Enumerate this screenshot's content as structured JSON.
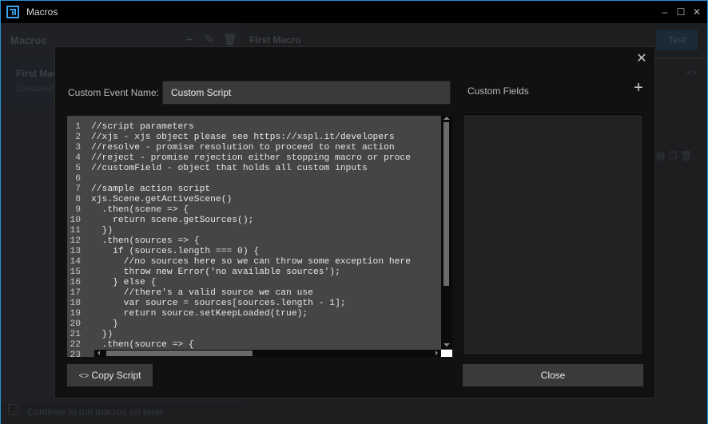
{
  "window": {
    "title": "Macros",
    "controls": {
      "minimize": "–",
      "maximize": "☐",
      "close": "✕"
    }
  },
  "background": {
    "left_header": "Macros",
    "left_icons": [
      "plus-icon",
      "edit-icon",
      "trash-icon"
    ],
    "macro_item": {
      "name": "First Macro",
      "status": "(Disabled)"
    },
    "right_title": "First Macro",
    "test_button": "Test",
    "code_icon": "<>",
    "footer_checkbox_label": "Continue to run macros on error"
  },
  "modal": {
    "close": "✕",
    "event_name_label": "Custom Event Name:",
    "event_name_value": "Custom Script",
    "custom_fields_label": "Custom Fields",
    "add_field": "+",
    "copy_button": "Copy Script",
    "copy_icon": "<>",
    "close_button": "Close",
    "code_lines": [
      {
        "n": "1",
        "text": "//script parameters"
      },
      {
        "n": "2",
        "text": "//xjs - xjs object please see https://xspl.it/developers"
      },
      {
        "n": "3",
        "text": "//resolve - promise resolution to proceed to next action"
      },
      {
        "n": "4",
        "text": "//reject - promise rejection either stopping macro or proce"
      },
      {
        "n": "5",
        "text": "//customField - object that holds all custom inputs"
      },
      {
        "n": "6",
        "text": ""
      },
      {
        "n": "7",
        "text": "//sample action script"
      },
      {
        "n": "8",
        "text": "xjs.Scene.getActiveScene()"
      },
      {
        "n": "9",
        "text": "  .then(scene => {"
      },
      {
        "n": "10",
        "text": "    return scene.getSources();"
      },
      {
        "n": "11",
        "text": "  })"
      },
      {
        "n": "12",
        "text": "  .then(sources => {"
      },
      {
        "n": "13",
        "text": "    if (sources.length === 0) {"
      },
      {
        "n": "14",
        "text": "      //no sources here so we can throw some exception here"
      },
      {
        "n": "15",
        "text": "      throw new Error('no available sources');"
      },
      {
        "n": "16",
        "text": "    } else {"
      },
      {
        "n": "17",
        "text": "      //there's a valid source we can use"
      },
      {
        "n": "18",
        "text": "      var source = sources[sources.length - 1];"
      },
      {
        "n": "19",
        "text": "      return source.setKeepLoaded(true);"
      },
      {
        "n": "20",
        "text": "    }"
      },
      {
        "n": "21",
        "text": "  })"
      },
      {
        "n": "22",
        "text": "  .then(source => {"
      },
      {
        "n": "23",
        "text": ""
      }
    ]
  }
}
